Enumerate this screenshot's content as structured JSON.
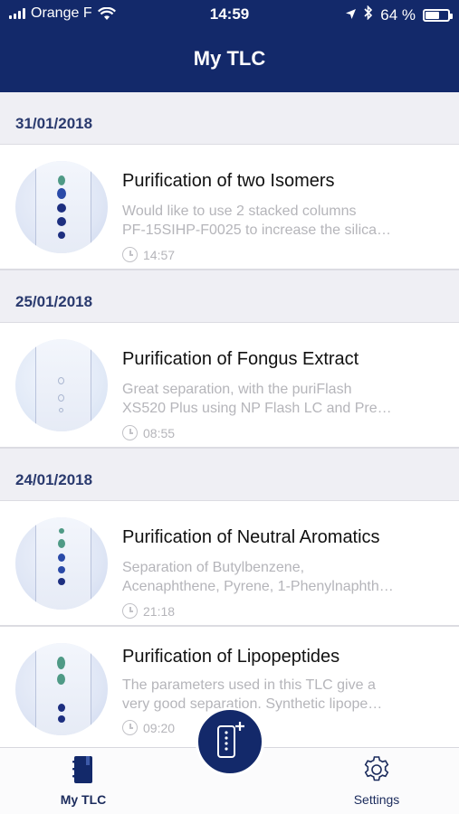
{
  "status_bar": {
    "carrier": "Orange F",
    "time": "14:59",
    "battery": "64 %",
    "battery_level": 0.64
  },
  "header": {
    "title": "My TLC"
  },
  "sections": [
    {
      "date": "31/01/2018",
      "items": [
        {
          "title": "Purification of two Isomers",
          "desc_line1": "Would like to use 2 stacked columns",
          "desc_line2": "PF-15SIHP-F0025 to increase the silica…",
          "time": "14:57"
        }
      ]
    },
    {
      "date": "25/01/2018",
      "items": [
        {
          "title": "Purification of Fongus Extract",
          "desc_line1": "Great separation, with the puriFlash",
          "desc_line2": "XS520 Plus using NP Flash LC and Pre…",
          "time": "08:55"
        }
      ]
    },
    {
      "date": "24/01/2018",
      "items": [
        {
          "title": "Purification of Neutral Aromatics",
          "desc_line1": "Separation of Butylbenzene,",
          "desc_line2": "Acenaphthene, Pyrene, 1-Phenylnaphth…",
          "time": "21:18"
        },
        {
          "title": "Purification of Lipopeptides",
          "desc_line1": "The parameters used in this TLC give a",
          "desc_line2": "very good separation. Synthetic lipope…",
          "time": "09:20"
        }
      ]
    }
  ],
  "tabbar": {
    "my_tlc_label": "My TLC",
    "settings_label": "Settings"
  },
  "colors": {
    "brand_navy": "#13296a",
    "section_text": "#2a3a6e",
    "muted_text": "#b5b5ba",
    "spot_green": "#4f9a86",
    "spot_blue": "#2a4aa8",
    "spot_navy": "#1d2f80"
  },
  "icons": {
    "tab_my_tlc": "notebook-icon",
    "fab": "tlc-plate-add-icon",
    "tab_settings": "gear-icon",
    "time": "clock-icon"
  }
}
